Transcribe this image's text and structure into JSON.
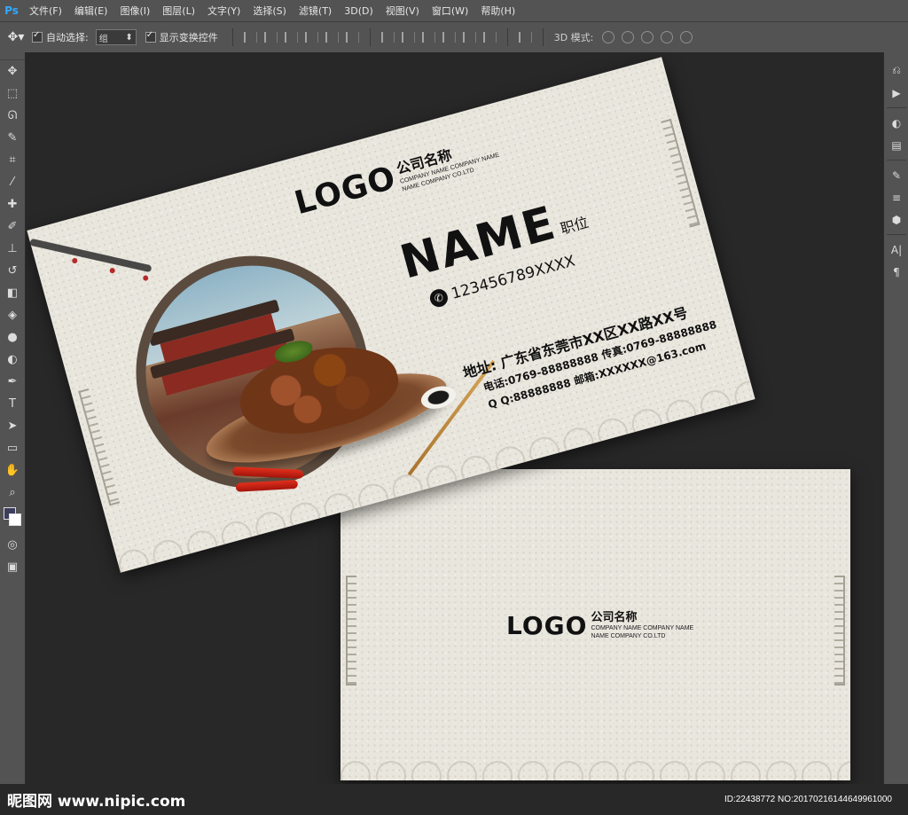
{
  "app": {
    "logo": "Ps"
  },
  "menu": [
    "文件(F)",
    "编辑(E)",
    "图像(I)",
    "图层(L)",
    "文字(Y)",
    "选择(S)",
    "滤镜(T)",
    "3D(D)",
    "视图(V)",
    "窗口(W)",
    "帮助(H)"
  ],
  "options": {
    "auto_select_label": "自动选择:",
    "auto_select_value": "组",
    "show_transform_label": "显示变换控件",
    "mode_3d_label": "3D 模式:"
  },
  "card_front": {
    "logo": "LOGO",
    "company_cn": "公司名称",
    "company_en_1": "COMPANY NAME COMPANY NAME",
    "company_en_2": "NAME COMPANY CO.LTD",
    "name": "NAME",
    "title": "职位",
    "phone": "123456789XXXX",
    "address": "地址:  广东省东莞市XX区XX路XX号",
    "tel_fax": "电话:0769-88888888  传真:0769-88888888",
    "qq_email": "Q Q:88888888  邮箱:XXXXXX@163.com"
  },
  "card_back": {
    "logo": "LOGO",
    "company_cn": "公司名称",
    "company_en_1": "COMPANY NAME COMPANY NAME",
    "company_en_2": "NAME COMPANY CO.LTD"
  },
  "watermark": {
    "site": "昵图网 www.nipic.com",
    "id": "ID:22438772 NO:20170216144649961000"
  }
}
